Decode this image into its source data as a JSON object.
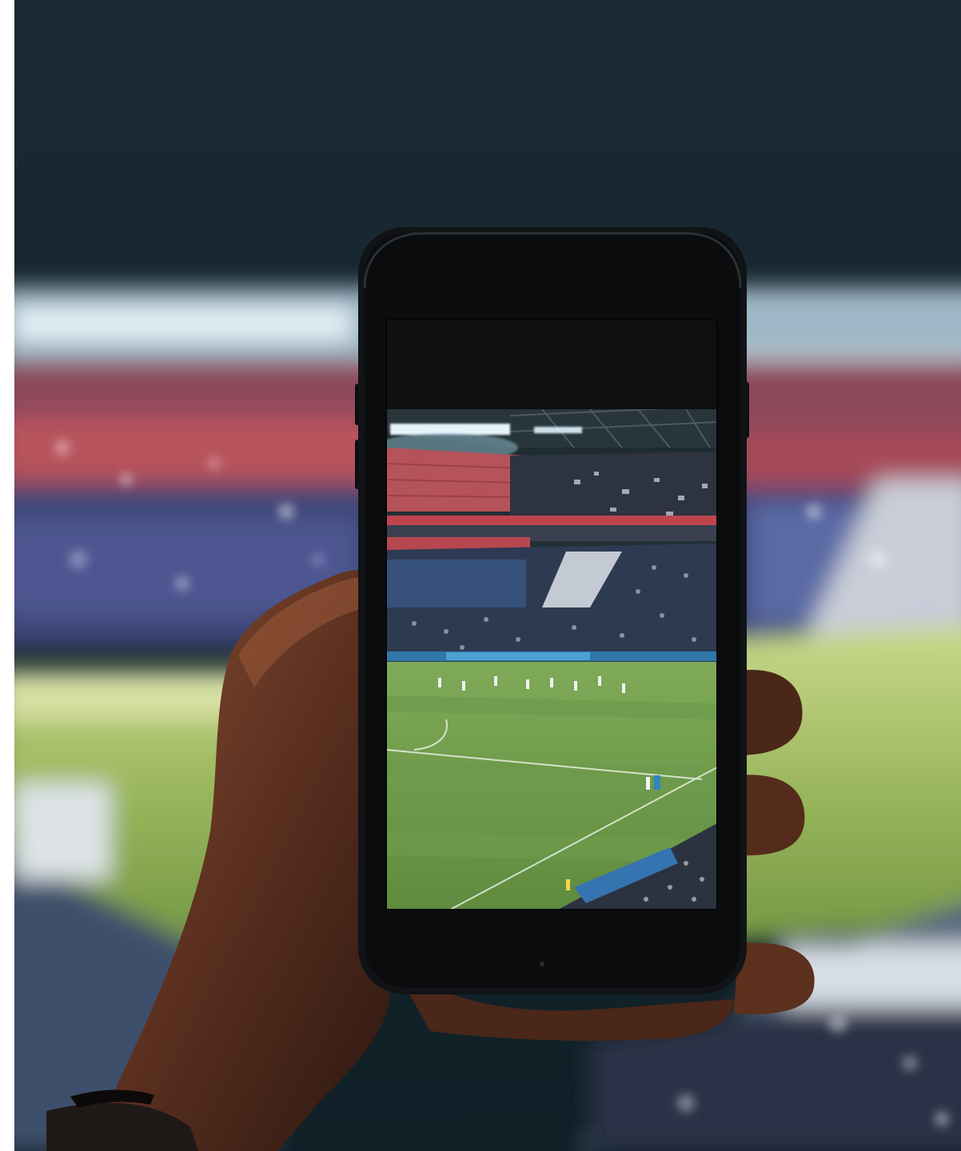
{
  "scene": {
    "subject": "hand-holding-phone",
    "background": "blurred-stadium",
    "phone_screen": "sharp-stadium-photo"
  },
  "colors": {
    "sky": "#14222b",
    "floodlight": "#dbe9f2",
    "crowd_red": "#b24b57",
    "crowd_blue": "#3c4d86",
    "pitch": "#6f9d4a",
    "pitch_dark": "#587f3a",
    "phone_body": "#101214",
    "skin": "#6a3a24",
    "skin_shadow": "#3e2114"
  }
}
